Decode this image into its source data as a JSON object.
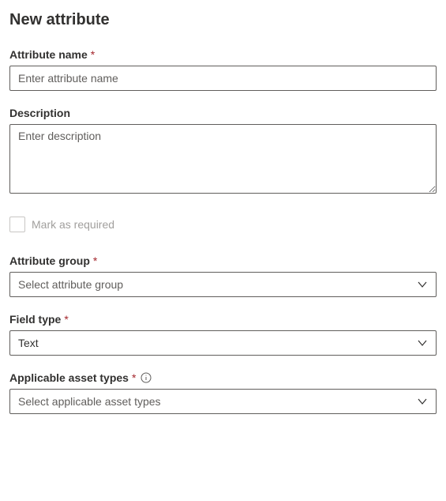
{
  "page": {
    "title": "New attribute"
  },
  "fields": {
    "attributeName": {
      "label": "Attribute name",
      "placeholder": "Enter attribute name",
      "value": "",
      "required": true
    },
    "description": {
      "label": "Description",
      "placeholder": "Enter description",
      "value": "",
      "required": false
    },
    "markRequired": {
      "label": "Mark as required",
      "checked": false,
      "disabled": true
    },
    "attributeGroup": {
      "label": "Attribute group",
      "placeholder": "Select attribute group",
      "value": "",
      "required": true
    },
    "fieldType": {
      "label": "Field type",
      "value": "Text",
      "required": true
    },
    "applicableAssetTypes": {
      "label": "Applicable asset types",
      "placeholder": "Select applicable asset types",
      "value": "",
      "required": true,
      "hasInfo": true
    }
  },
  "symbols": {
    "asterisk": "*"
  }
}
